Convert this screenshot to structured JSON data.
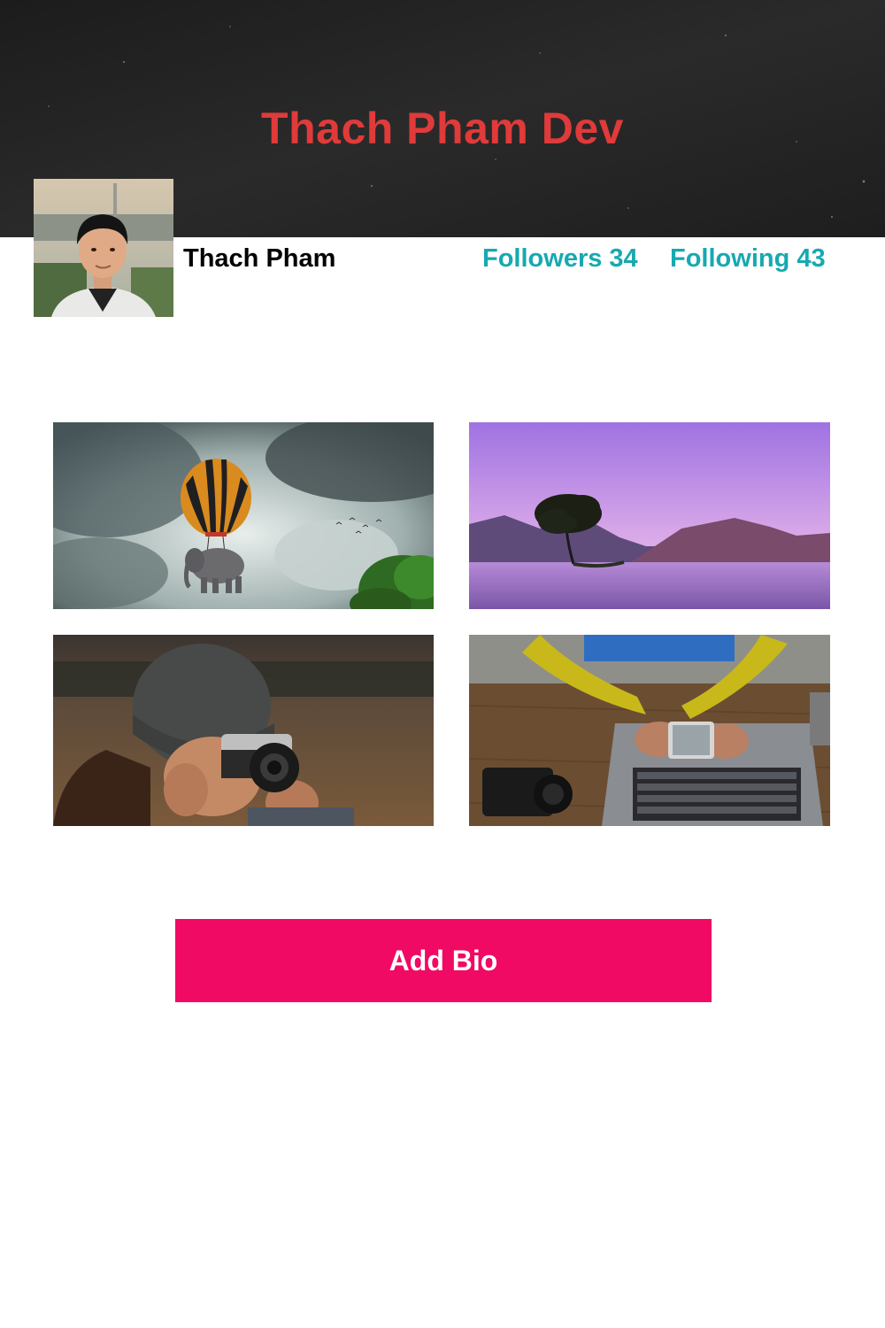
{
  "header": {
    "title": "Thach Pham Dev",
    "background_color": "#232323",
    "title_color": "#e03a3a"
  },
  "profile": {
    "name": "Thach Pham",
    "followers_label": "Followers 34",
    "following_label": "Following 43",
    "stat_color": "#17a9b1"
  },
  "gallery": {
    "photos": [
      "hot-air-balloon-elephant-photo",
      "purple-lake-tree-photo",
      "photographer-camera-photo",
      "laptop-phone-desk-photo"
    ]
  },
  "actions": {
    "add_bio_label": "Add Bio",
    "add_bio_color": "#f00a63"
  }
}
